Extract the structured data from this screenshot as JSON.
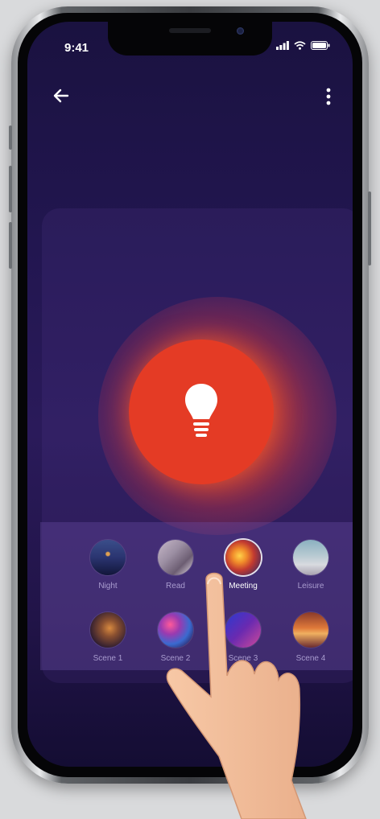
{
  "status_bar": {
    "time": "9:41"
  },
  "header": {
    "back_icon": "arrow-left-icon",
    "more_icon": "more-vertical-icon"
  },
  "light": {
    "icon": "lightbulb-icon",
    "color": "#e43b25",
    "state": "on"
  },
  "scenes": {
    "selected": "Meeting",
    "items": [
      {
        "label": "Night"
      },
      {
        "label": "Read"
      },
      {
        "label": "Meeting"
      },
      {
        "label": "Leisure"
      },
      {
        "label": "Scene 1"
      },
      {
        "label": "Scene 2"
      },
      {
        "label": "Scene 3"
      },
      {
        "label": "Scene 4"
      }
    ]
  },
  "colors": {
    "accent": "#e43b25",
    "background": "#1f1548"
  }
}
